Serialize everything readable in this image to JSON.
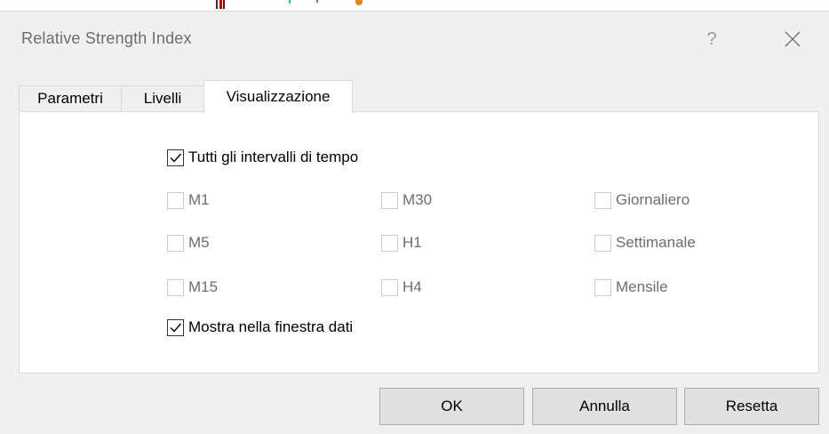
{
  "dialog": {
    "title": "Relative Strength Index",
    "help_label": "?"
  },
  "tabs": [
    {
      "label": "Parametri",
      "active": false
    },
    {
      "label": "Livelli",
      "active": false
    },
    {
      "label": "Visualizzazione",
      "active": true
    }
  ],
  "visualization": {
    "all_timeframes": {
      "label": "Tutti gli intervalli di tempo",
      "checked": true
    },
    "timeframes": [
      {
        "label": "M1",
        "checked": false,
        "enabled": false
      },
      {
        "label": "M5",
        "checked": false,
        "enabled": false
      },
      {
        "label": "M15",
        "checked": false,
        "enabled": false
      },
      {
        "label": "M30",
        "checked": false,
        "enabled": false
      },
      {
        "label": "H1",
        "checked": false,
        "enabled": false
      },
      {
        "label": "H4",
        "checked": false,
        "enabled": false
      },
      {
        "label": "Giornaliero",
        "checked": false,
        "enabled": false
      },
      {
        "label": "Settimanale",
        "checked": false,
        "enabled": false
      },
      {
        "label": "Mensile",
        "checked": false,
        "enabled": false
      }
    ],
    "show_in_data_window": {
      "label": "Mostra nella finestra dati",
      "checked": true
    }
  },
  "buttons": {
    "ok_label": "OK",
    "cancel_label": "Annulla",
    "reset_label": "Resetta"
  },
  "colors": {
    "checkmark": "#000000",
    "disabled_text": "#6d6d6d",
    "disabled_border": "#cccccc"
  }
}
